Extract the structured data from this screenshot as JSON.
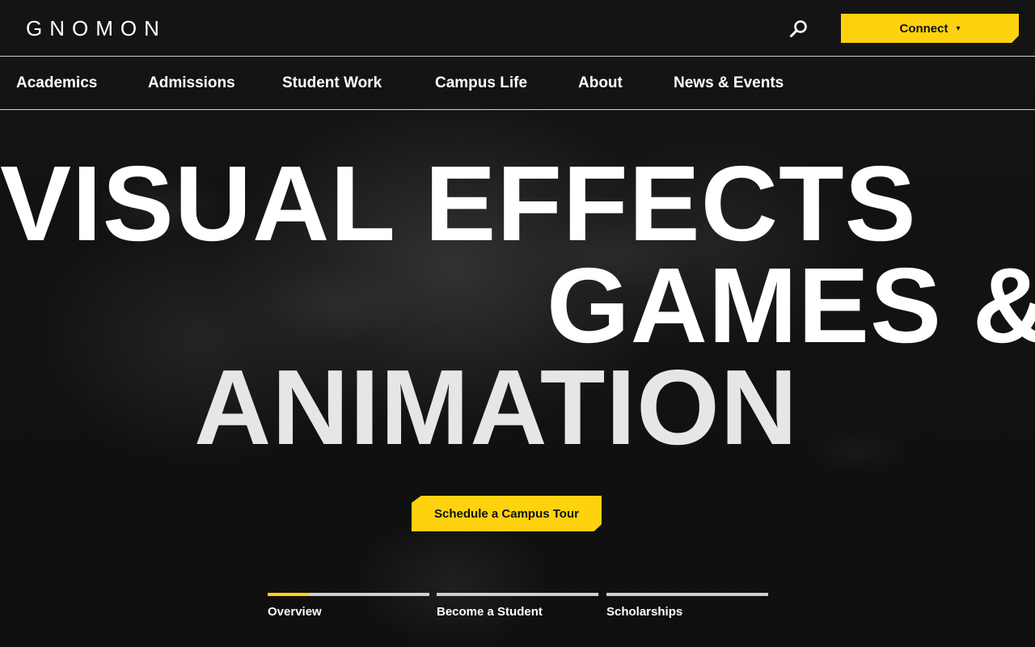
{
  "brand": {
    "logo_text": "GNOMON"
  },
  "header": {
    "search_icon": "search-icon",
    "connect_label": "Connect",
    "connect_caret": "▾",
    "accent_color": "#ffd20f"
  },
  "nav": {
    "items": [
      {
        "label": "Academics"
      },
      {
        "label": "Admissions"
      },
      {
        "label": "Student Work"
      },
      {
        "label": "Campus Life"
      },
      {
        "label": "About"
      },
      {
        "label": "News & Events"
      }
    ]
  },
  "hero": {
    "line1": "VISUAL EFFECTS",
    "line2": "GAMES &",
    "line3": "ANIMATION",
    "cta_label": "Schedule a Campus Tour"
  },
  "tabs": [
    {
      "label": "Overview",
      "progress": 0.26,
      "active": true
    },
    {
      "label": "Become a Student",
      "progress": 0,
      "active": false
    },
    {
      "label": "Scholarships",
      "progress": 0,
      "active": false
    }
  ]
}
